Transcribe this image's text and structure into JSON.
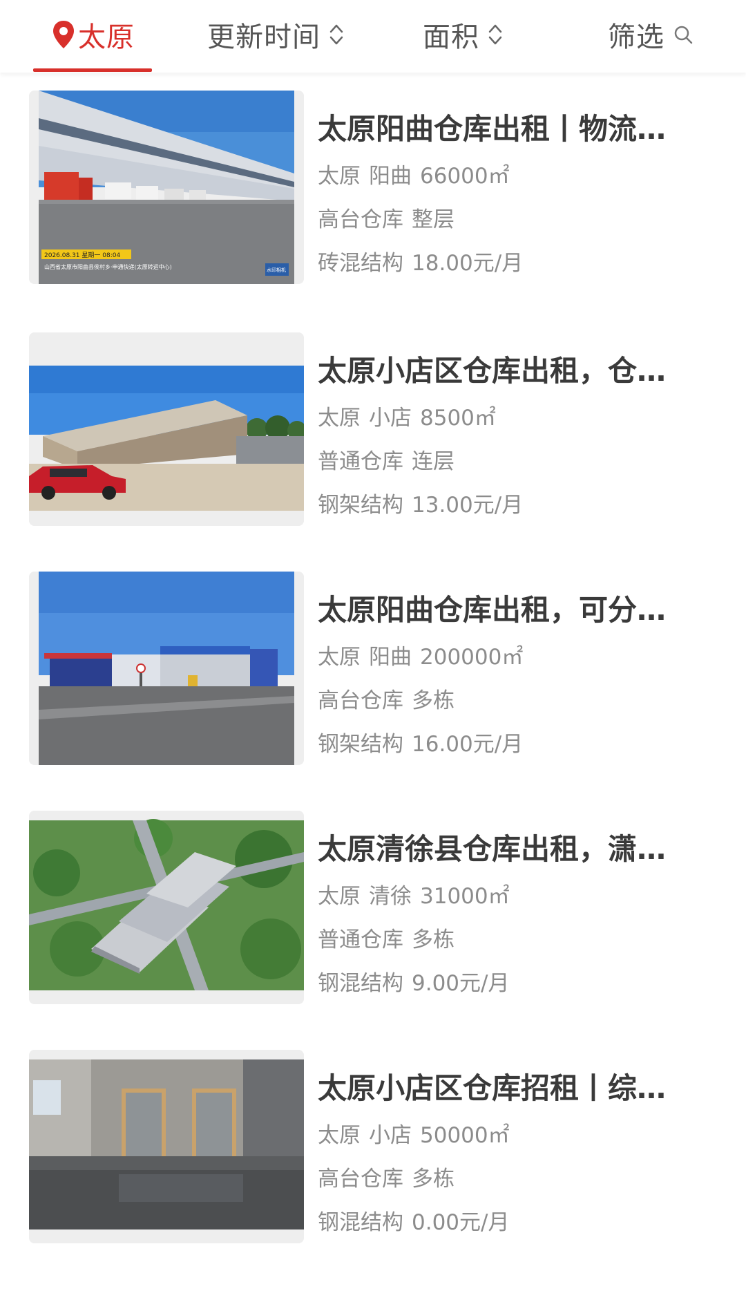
{
  "filter_bar": {
    "location": "太原",
    "update_time": "更新时间",
    "area": "面积",
    "filter": "筛选"
  },
  "listings": [
    {
      "title": "太原阳曲仓库出租丨物流…",
      "city": "太原",
      "district": "阳曲",
      "area": "66000㎡",
      "warehouse_type": "高台仓库",
      "floor": "整层",
      "structure": "砖混结构",
      "price": "18.00元/月",
      "photo": {
        "stamp_date": "2026.08.31 星期一 08:04",
        "stamp_address": "山西省太原市阳曲县侯村乡·申通快递(太原转运中心)",
        "stamp_brand": "水印相机"
      }
    },
    {
      "title": "太原小店区仓库出租，仓…",
      "city": "太原",
      "district": "小店",
      "area": "8500㎡",
      "warehouse_type": "普通仓库",
      "floor": "连层",
      "structure": "钢架结构",
      "price": "13.00元/月"
    },
    {
      "title": "太原阳曲仓库出租，可分…",
      "city": "太原",
      "district": "阳曲",
      "area": "200000㎡",
      "warehouse_type": "高台仓库",
      "floor": "多栋",
      "structure": "钢架结构",
      "price": "16.00元/月"
    },
    {
      "title": "太原清徐县仓库出租，潇…",
      "city": "太原",
      "district": "清徐",
      "area": "31000㎡",
      "warehouse_type": "普通仓库",
      "floor": "多栋",
      "structure": "钢混结构",
      "price": "9.00元/月"
    },
    {
      "title": "太原小店区仓库招租丨综…",
      "city": "太原",
      "district": "小店",
      "area": "50000㎡",
      "warehouse_type": "高台仓库",
      "floor": "多栋",
      "structure": "钢混结构",
      "price": "0.00元/月"
    }
  ],
  "colors": {
    "accent": "#d8302b",
    "title": "#3a3a3a",
    "meta": "#8c8c8c"
  }
}
